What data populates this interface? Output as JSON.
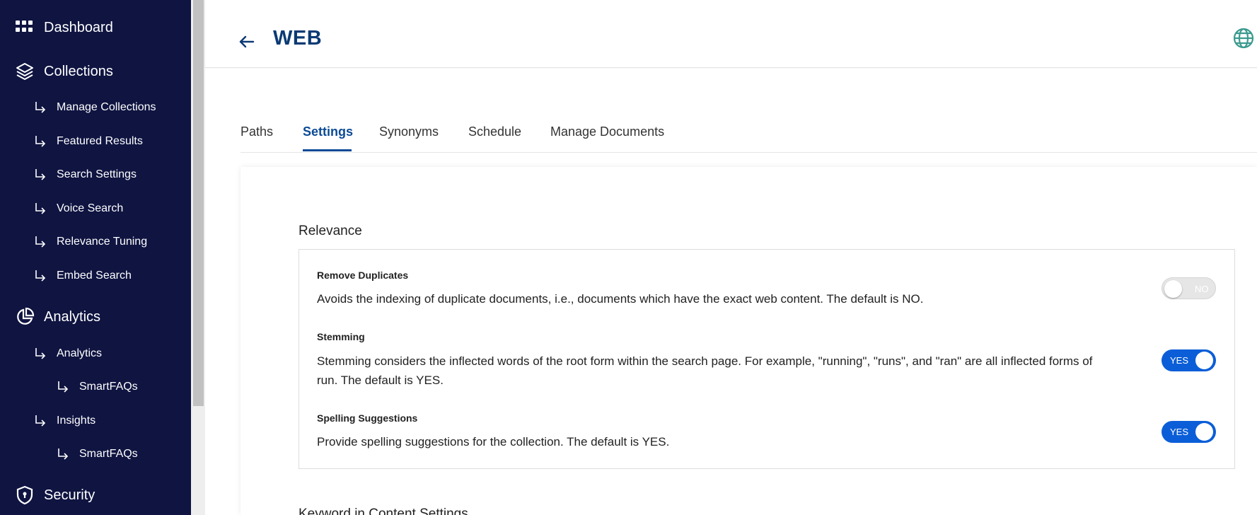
{
  "sidebar": {
    "dashboard": "Dashboard",
    "collections": "Collections",
    "collections_items": [
      "Manage Collections",
      "Featured Results",
      "Search Settings",
      "Voice Search",
      "Relevance Tuning",
      "Embed Search"
    ],
    "analytics": "Analytics",
    "analytics_sub": "Analytics",
    "analytics_smartfaqs": "SmartFAQs",
    "insights": "Insights",
    "insights_smartfaqs": "SmartFAQs",
    "security": "Security"
  },
  "header": {
    "title": "WEB"
  },
  "tabs": [
    "Paths",
    "Settings",
    "Synonyms",
    "Schedule",
    "Manage Documents"
  ],
  "active_tab": "Settings",
  "relevance": {
    "title": "Relevance",
    "settings": [
      {
        "title": "Remove Duplicates",
        "description": "Avoids the indexing of duplicate documents, i.e., documents which have the exact web content. The default is NO.",
        "toggle": "NO"
      },
      {
        "title": "Stemming",
        "description": "Stemming considers the inflected words of the root form within the search page. For example, \"running\", \"runs\", and \"ran\" are all inflected forms of run. The default is YES.",
        "toggle": "YES"
      },
      {
        "title": "Spelling Suggestions",
        "description": "Provide spelling suggestions for the collection. The default is YES.",
        "toggle": "YES"
      }
    ]
  },
  "next_section_title": "Keyword in Content Settings",
  "colors": {
    "sidebar_bg": "#0f1441",
    "accent": "#0b4a96",
    "toggle_on": "#0b5ed7",
    "toggle_off": "#e6e6e6"
  },
  "icons": [
    "grid-icon",
    "layers-icon",
    "pie-chart-icon",
    "shield-icon",
    "subitem-arrow-icon",
    "back-arrow-icon",
    "globe-icon"
  ]
}
